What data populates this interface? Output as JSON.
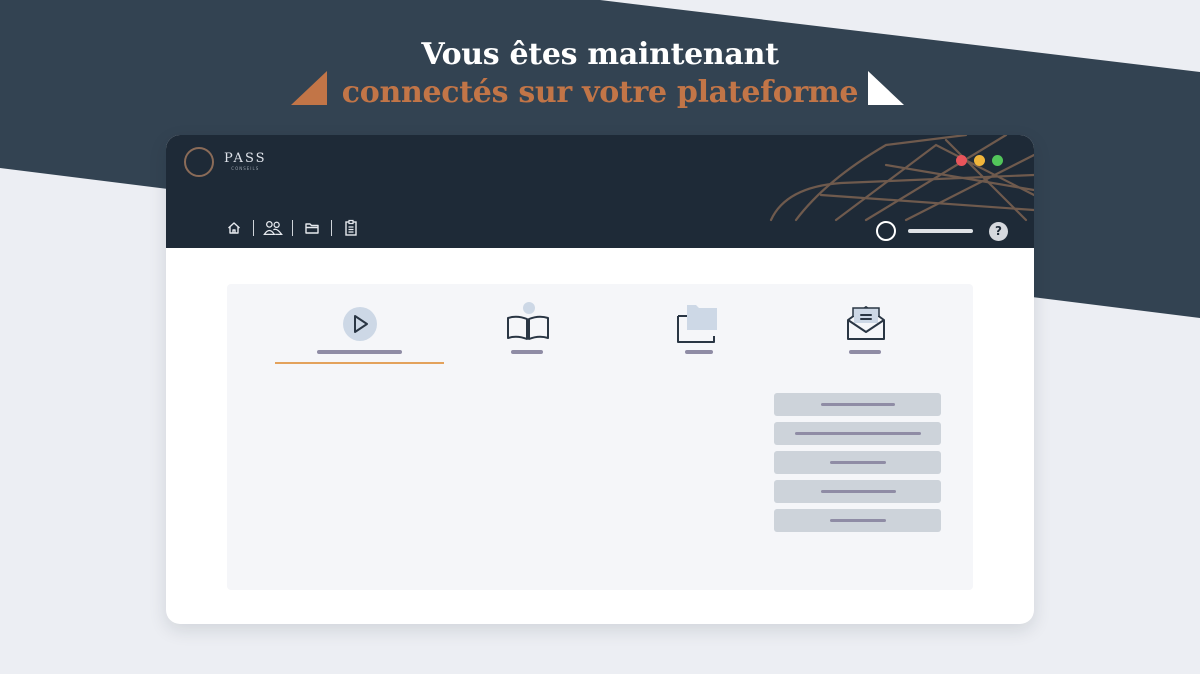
{
  "headline": {
    "line1": "Vous êtes maintenant",
    "line2": "connectés sur votre plateforme"
  },
  "colors": {
    "dark_band": "#334352",
    "accent_copper": "#c27547",
    "window_bar": "#1e2a37",
    "tab_underline": "#e3a25c",
    "placeholder_bar": "#8f8ca5"
  },
  "app": {
    "brand_name": "PASS",
    "brand_sub": "CONSEILS"
  },
  "window_controls": [
    "close-dot",
    "minimize-dot",
    "maximize-dot"
  ],
  "nav_icons": [
    "home-icon",
    "users-icon",
    "folder-icon",
    "clipboard-icon"
  ],
  "user": {
    "help_glyph": "?"
  },
  "tabs": [
    {
      "icon": "play-icon",
      "active": true
    },
    {
      "icon": "book-icon",
      "active": false
    },
    {
      "icon": "folder-icon",
      "active": false
    },
    {
      "icon": "mail-icon",
      "active": false
    }
  ],
  "menu_items_count": 5
}
